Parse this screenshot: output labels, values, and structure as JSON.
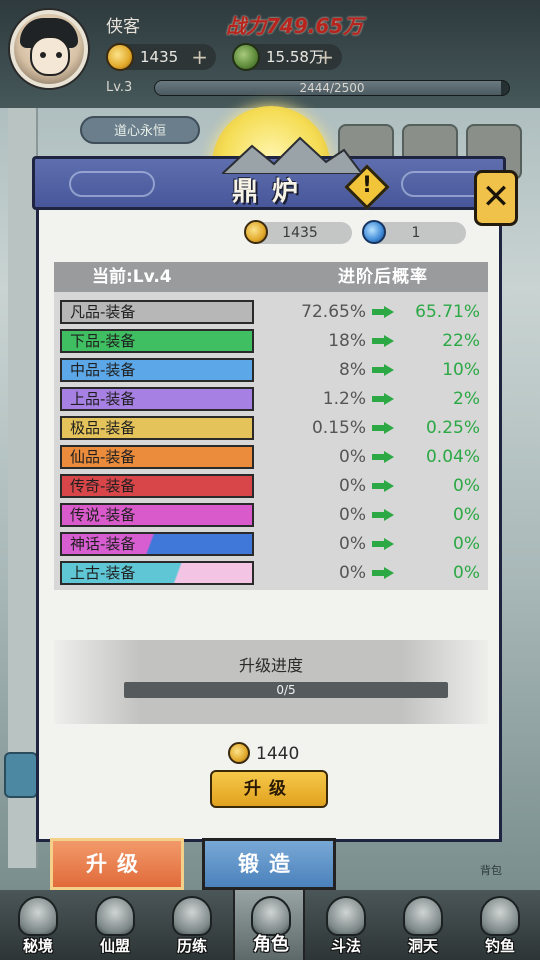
{
  "player": {
    "name": "侠客",
    "combat_power": "战力749.65万",
    "coins": "1435",
    "jade": "15.58万",
    "level": "Lv.3",
    "xp_text": "2444/2500",
    "xp_fraction": 0.9776,
    "badge": "道心永恒"
  },
  "modal": {
    "title": "鼎炉",
    "currency": {
      "coins": "1435",
      "gems": "1"
    },
    "table": {
      "current_label": "当前:Lv.4",
      "prob_label": "进阶后概率",
      "rows": [
        {
          "tier": "凡品-装备",
          "before": "72.65%",
          "after": "65.71%",
          "color": "#b7b7b7"
        },
        {
          "tier": "下品-装备",
          "before": "18%",
          "after": "22%",
          "color": "#3fbf62"
        },
        {
          "tier": "中品-装备",
          "before": "8%",
          "after": "10%",
          "color": "#5ba7e8"
        },
        {
          "tier": "上品-装备",
          "before": "1.2%",
          "after": "2%",
          "color": "#a780e3"
        },
        {
          "tier": "极品-装备",
          "before": "0.15%",
          "after": "0.25%",
          "color": "#e4c35a"
        },
        {
          "tier": "仙品-装备",
          "before": "0%",
          "after": "0.04%",
          "color": "#ea8c3c"
        },
        {
          "tier": "传奇-装备",
          "before": "0%",
          "after": "0%",
          "color": "#d8464a"
        },
        {
          "tier": "传说-装备",
          "before": "0%",
          "after": "0%",
          "color": "#d95acb"
        },
        {
          "tier": "神话-装备",
          "before": "0%",
          "after": "0%",
          "color": "#d75ed0",
          "color2": "#3f78d8"
        },
        {
          "tier": "上古-装备",
          "before": "0%",
          "after": "0%",
          "color": "#f3c4e4",
          "color2": "#5fc6d6"
        }
      ]
    },
    "progress": {
      "label": "升级进度",
      "text": "0/5",
      "fraction": 0
    },
    "cost": "1440",
    "upgrade_button": "升级"
  },
  "tabs": {
    "upgrade": "升级",
    "forge": "锻造",
    "backpack": "背包"
  },
  "nav": [
    {
      "label": "秘境",
      "icon": "secret-realm-icon"
    },
    {
      "label": "仙盟",
      "icon": "immortal-alliance-icon"
    },
    {
      "label": "历练",
      "icon": "training-icon"
    },
    {
      "label": "角色",
      "icon": "character-icon",
      "active": true
    },
    {
      "label": "斗法",
      "icon": "duel-icon"
    },
    {
      "label": "洞天",
      "icon": "cave-heaven-icon"
    },
    {
      "label": "钓鱼",
      "icon": "fishing-icon"
    }
  ],
  "colors": {
    "arrow_green": "#2ca845",
    "accent_gold": "#f1c24a",
    "modal_header": "#5565a8"
  }
}
